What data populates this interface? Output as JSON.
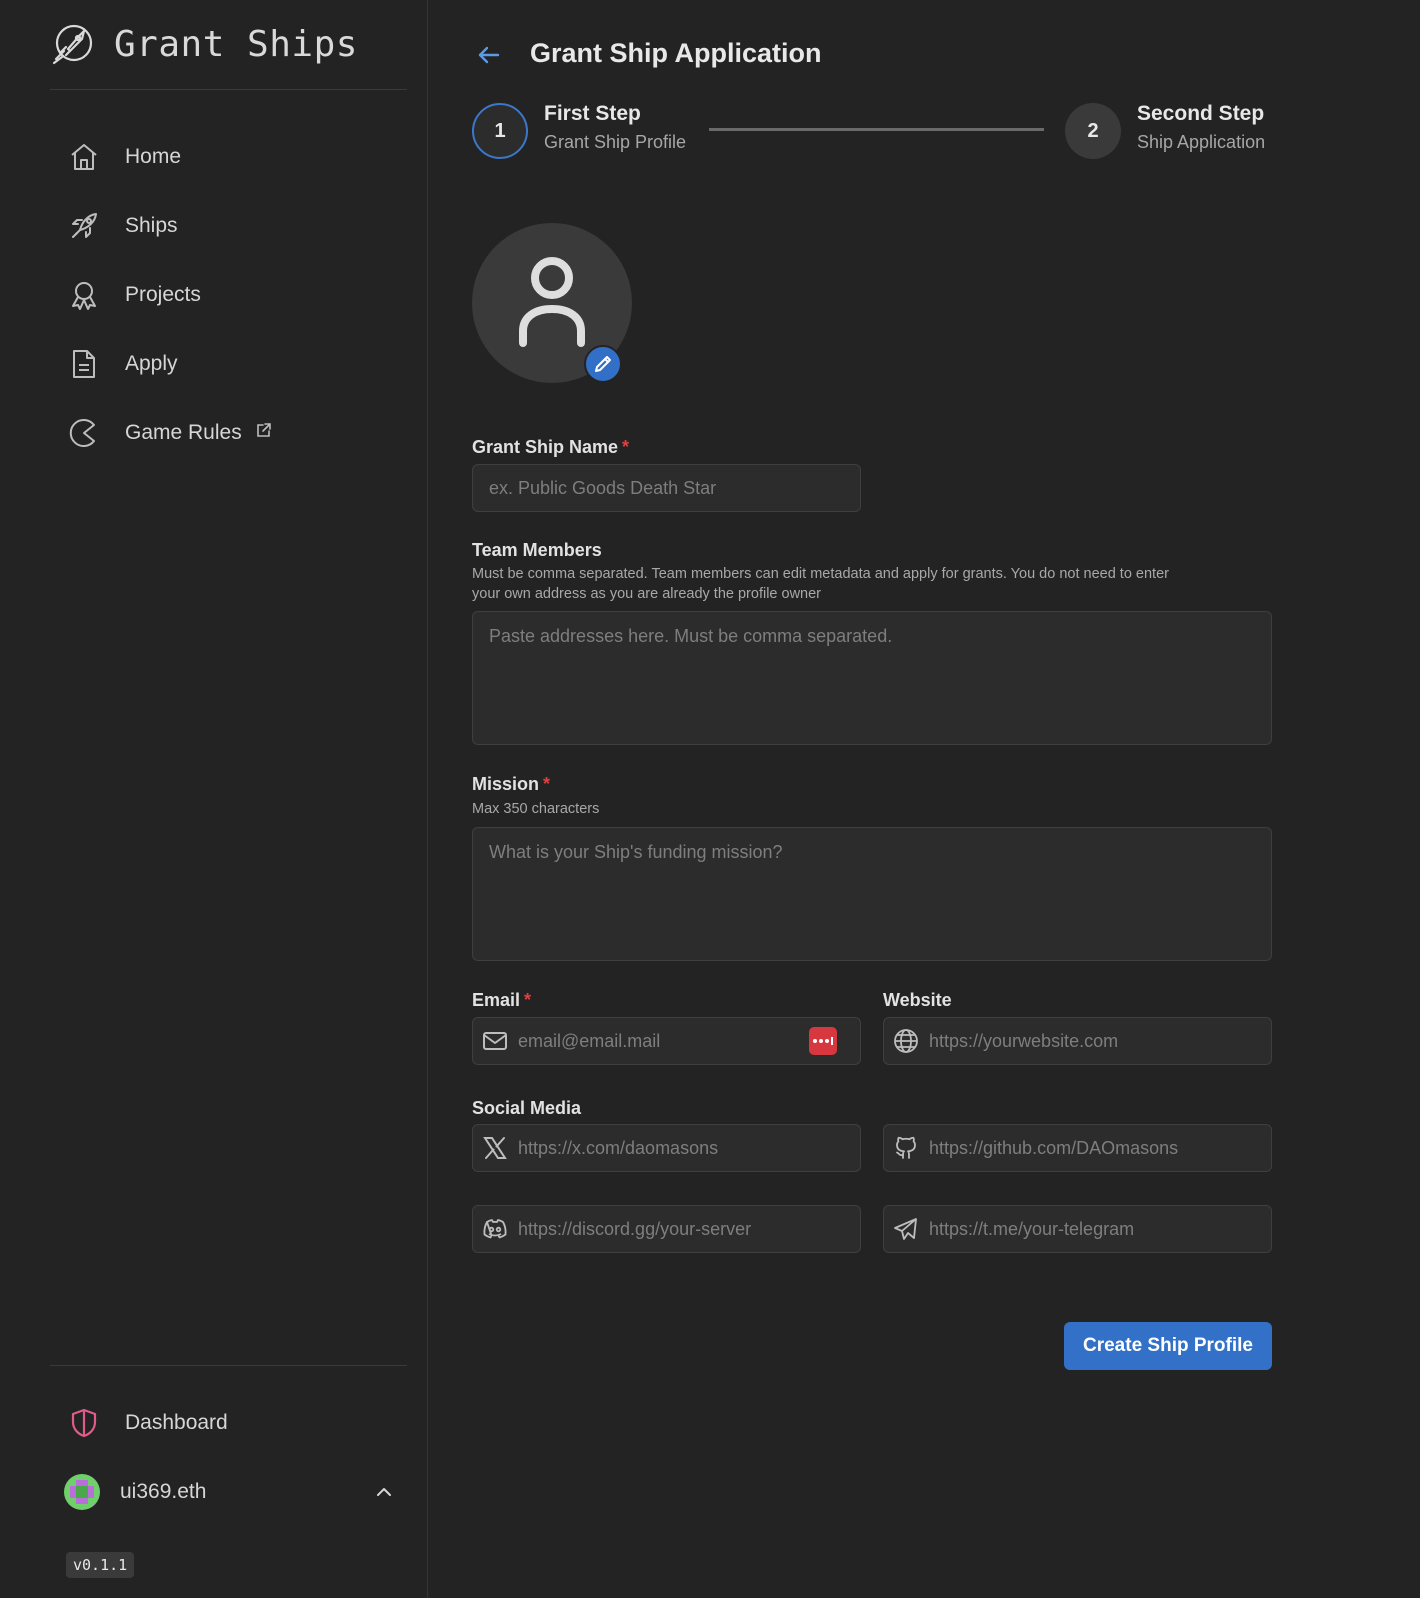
{
  "brand": {
    "name": "Grant Ships"
  },
  "sidebar": {
    "items": [
      {
        "label": "Home",
        "icon": "home-icon"
      },
      {
        "label": "Ships",
        "icon": "rocket-icon"
      },
      {
        "label": "Projects",
        "icon": "award-icon"
      },
      {
        "label": "Apply",
        "icon": "document-icon"
      },
      {
        "label": "Game Rules",
        "icon": "pacman-icon"
      }
    ],
    "dashboard_label": "Dashboard",
    "user_name": "ui369.eth",
    "version": "v0.1.1"
  },
  "header": {
    "title": "Grant Ship Application"
  },
  "steps": [
    {
      "number": "1",
      "title": "First Step",
      "subtitle": "Grant Ship Profile"
    },
    {
      "number": "2",
      "title": "Second Step",
      "subtitle": "Ship Application"
    }
  ],
  "form": {
    "name": {
      "label": "Grant Ship Name",
      "required_mark": "*",
      "placeholder": "ex. Public Goods Death Star"
    },
    "team": {
      "label": "Team Members",
      "help_line1": "Must be comma separated. Team members can edit metadata and apply for grants. You do not need to enter",
      "help_line2": "your own address as you are already the profile owner",
      "placeholder": "Paste addresses here. Must be comma separated."
    },
    "mission": {
      "label": "Mission",
      "required_mark": "*",
      "help": "Max 350 characters",
      "placeholder": "What is your Ship's funding mission?"
    },
    "email": {
      "label": "Email",
      "required_mark": "*",
      "placeholder": "email@email.mail"
    },
    "website": {
      "label": "Website",
      "placeholder": "https://yourwebsite.com"
    },
    "social": {
      "label": "Social Media",
      "x_placeholder": "https://x.com/daomasons",
      "github_placeholder": "https://github.com/DAOmasons",
      "discord_placeholder": "https://discord.gg/your-server",
      "telegram_placeholder": "https://t.me/your-telegram"
    },
    "submit_label": "Create Ship Profile"
  },
  "colors": {
    "accent": "#3271c7",
    "required": "#e53e3e",
    "dashboard_icon": "#e05a8a"
  }
}
